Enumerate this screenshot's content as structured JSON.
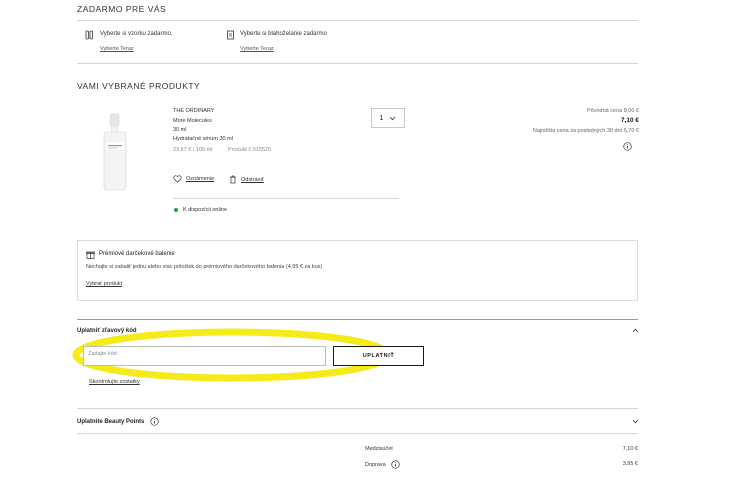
{
  "free_section": {
    "title": "ZADARMO PRE VÁS",
    "samples": {
      "label": "Vyberte si vzorku zadarmo.",
      "link": "Vyberte Teraz",
      "icon": "sample-vials-icon"
    },
    "gift": {
      "label": "Vyberte si blahoželanie zadarmo",
      "link": "Vyberte Teraz",
      "icon": "gift-card-icon"
    }
  },
  "products_section": {
    "title": "VAMI VYBRANÉ PRODUKTY",
    "product": {
      "brand": "THE ORDINARY",
      "name": "More Molecules",
      "volume": "30 ml",
      "type": "Hydratačné sérum 30 ml",
      "unit_price": "23,67 € / 100 ml",
      "product_no": "Produkt č.015520",
      "notify_label": "Oznámenie",
      "remove_label": "Odstrániť",
      "availability": "K dispozícii online",
      "availability_color": "#2e9e3a",
      "quantity": "1",
      "original_price": "Pôvodná cena 8,00 €",
      "price": "7,10 €",
      "lowest_price": "Najnižšia cena za posledných 30 dní 5,70 €"
    }
  },
  "gift_wrap": {
    "title": "Prémiové darčekové balenie",
    "description": "Nechajte si zabaliť jednu alebo viac položiek do prémiového darčekového balenia (4,95 € za kus)",
    "link": "Vybrať produkt"
  },
  "discount": {
    "title": "Uplatniť zľavový kód",
    "placeholder": "Zadajte kód",
    "apply_label": "UPLATNIŤ",
    "check_link": "Skontrolujte zostatky",
    "highlight_color": "#f5ea1a"
  },
  "beauty_points": {
    "title": "Uplatnite Beauty Points"
  },
  "summary": {
    "subtotal_label": "Medzisúčet",
    "subtotal_value": "7,10 €",
    "shipping_label": "Doprava",
    "shipping_value": "3,95 €"
  }
}
